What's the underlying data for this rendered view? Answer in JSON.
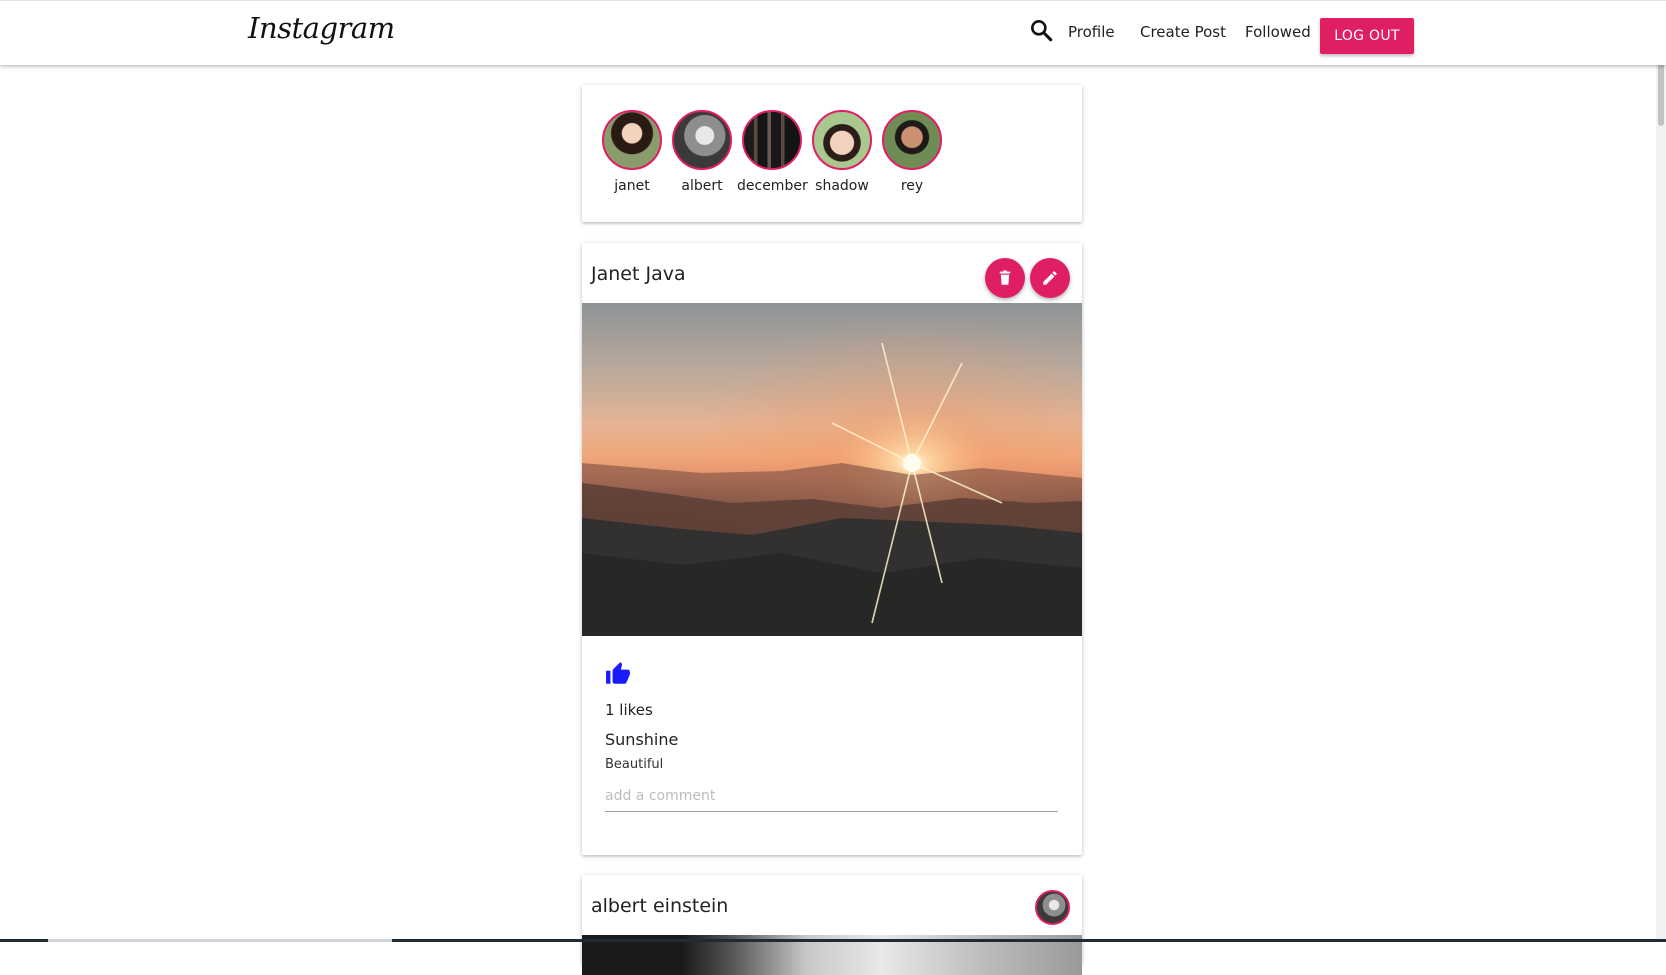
{
  "navbar": {
    "brand": "Instagram",
    "links": {
      "profile": "Profile",
      "create_post": "Create Post",
      "followed": "Followed"
    },
    "logout_label": "LOG OUT",
    "search_icon": "search-icon"
  },
  "stories": [
    {
      "name": "janet"
    },
    {
      "name": "albert"
    },
    {
      "name": "december"
    },
    {
      "name": "shadow"
    },
    {
      "name": "rey"
    }
  ],
  "posts": [
    {
      "author": "Janet Java",
      "likes_text": "1 likes",
      "title": "Sunshine",
      "body": "Beautiful",
      "comment_placeholder": "add a comment",
      "comment_value": "",
      "icons": [
        "delete-icon",
        "edit-icon",
        "thumb-up-icon"
      ]
    },
    {
      "author": "albert einstein"
    }
  ],
  "colors": {
    "accent": "#e01e64",
    "like": "#1a1aff"
  }
}
